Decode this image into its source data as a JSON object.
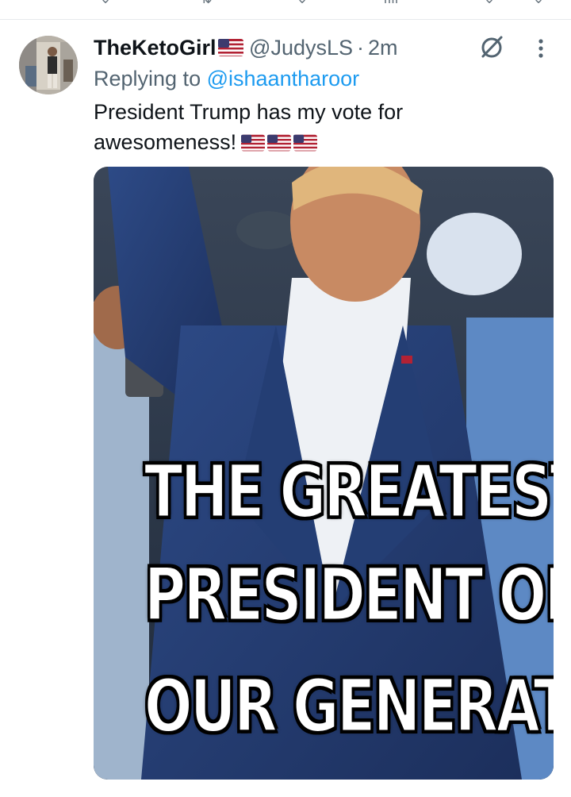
{
  "tweet": {
    "display_name": "TheKetoGirl",
    "handle": "@JudysLS",
    "separator": "·",
    "time": "2m",
    "replying_prefix": "Replying to",
    "replying_to": "@ishaantharoor",
    "text_line1": "President Trump has my vote for",
    "text_line2": "awesomeness!",
    "flag_emoji_count": 3,
    "media": {
      "caption_line1": "THE GREATEST",
      "caption_line2": "PRESIDENT OF",
      "caption_line3": "OUR GENERATION"
    }
  },
  "icons": {
    "grok": "grok-slash-circle-icon",
    "more": "more-vertical-icon",
    "flag": "us-flag-icon"
  },
  "colors": {
    "text_primary": "#0f1419",
    "text_secondary": "#536471",
    "link": "#1d9bf0",
    "divider": "#e6e9ec"
  }
}
